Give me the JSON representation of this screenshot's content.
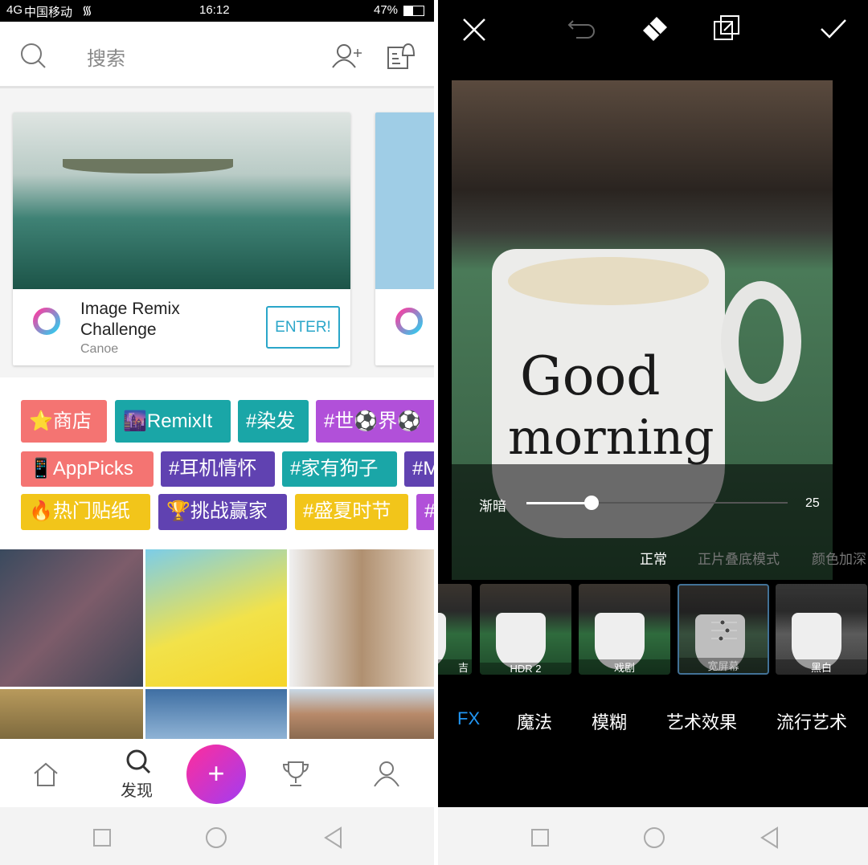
{
  "left": {
    "status": {
      "carrier": "中国移动",
      "signal": "4G",
      "time": "16:12",
      "battery": "47%"
    },
    "search": {
      "placeholder": "搜索"
    },
    "card": {
      "title_line1": "Image Remix",
      "title_line2": "Challenge",
      "subtitle": "Canoe",
      "button": "ENTER!"
    },
    "tags": [
      {
        "label": "⭐商店",
        "color": "#f47472"
      },
      {
        "label": "🌆RemixIt",
        "color": "#1aa6a7"
      },
      {
        "label": "#染发",
        "color": "#1aa6a7"
      },
      {
        "label": "#世⚽界⚽",
        "color": "#b150d9"
      },
      {
        "label": "📱AppPicks",
        "color": "#f47472"
      },
      {
        "label": "#耳机情怀",
        "color": "#6042b1"
      },
      {
        "label": "#家有狗子",
        "color": "#1aa6a7"
      },
      {
        "label": "#M",
        "color": "#6042b1"
      },
      {
        "label": "🔥热门贴纸",
        "color": "#f2c51a"
      },
      {
        "label": "🏆挑战赢家",
        "color": "#6042b1"
      },
      {
        "label": "#盛夏时节",
        "color": "#f2c51a"
      },
      {
        "label": "#",
        "color": "#b150d9"
      }
    ],
    "nav": {
      "discover": "发现",
      "plus": "+"
    }
  },
  "right": {
    "slider": {
      "label": "渐暗",
      "value": "25",
      "fraction": 0.25
    },
    "blend_modes": [
      "正常",
      "正片叠底模式",
      "颜色加深"
    ],
    "filters": [
      "吉",
      "HDR 2",
      "戏剧",
      "宽屏幕",
      "黑白"
    ],
    "categories": [
      "FX",
      "魔法",
      "模糊",
      "艺术效果",
      "流行艺术"
    ],
    "photo_text": [
      "Good",
      "morning"
    ],
    "accent": "#2196f3"
  }
}
